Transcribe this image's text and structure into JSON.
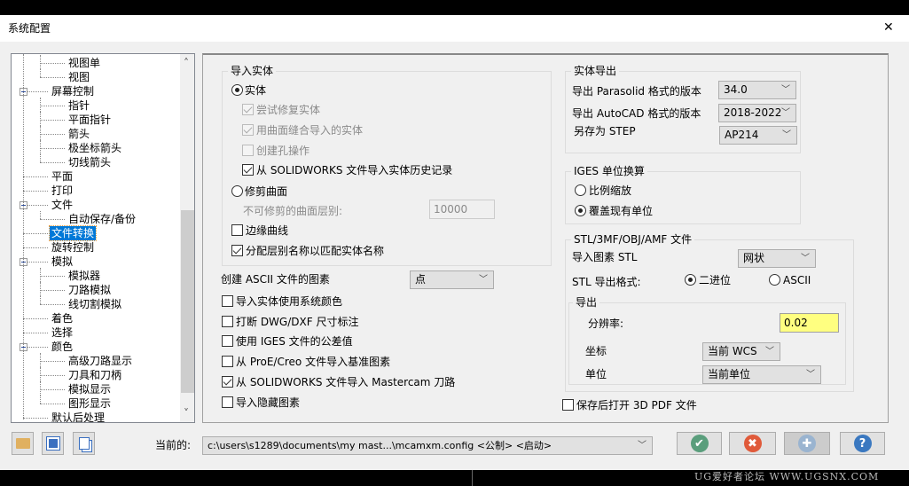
{
  "window": {
    "title": "系统配置",
    "close": "✕"
  },
  "tree": {
    "items": [
      {
        "label": "视图单",
        "level": 2
      },
      {
        "label": "视图",
        "level": 2,
        "last": true
      },
      {
        "label": "屏幕控制",
        "level": 1,
        "expander": true
      },
      {
        "label": "指针",
        "level": 2
      },
      {
        "label": "平面指针",
        "level": 2
      },
      {
        "label": "箭头",
        "level": 2
      },
      {
        "label": "极坐标箭头",
        "level": 2
      },
      {
        "label": "切线箭头",
        "level": 2,
        "last": true
      },
      {
        "label": "平面",
        "level": 1
      },
      {
        "label": "打印",
        "level": 1
      },
      {
        "label": "文件",
        "level": 1,
        "expander": true
      },
      {
        "label": "自动保存/备份",
        "level": 2,
        "last": true
      },
      {
        "label": "文件转换",
        "level": 1,
        "selected": true
      },
      {
        "label": "旋转控制",
        "level": 1
      },
      {
        "label": "模拟",
        "level": 1,
        "expander": true
      },
      {
        "label": "模拟器",
        "level": 2
      },
      {
        "label": "刀路模拟",
        "level": 2
      },
      {
        "label": "线切割模拟",
        "level": 2,
        "last": true
      },
      {
        "label": "着色",
        "level": 1
      },
      {
        "label": "选择",
        "level": 1
      },
      {
        "label": "颜色",
        "level": 1,
        "expander": true
      },
      {
        "label": "高级刀路显示",
        "level": 2
      },
      {
        "label": "刀具和刀柄",
        "level": 2
      },
      {
        "label": "模拟显示",
        "level": 2
      },
      {
        "label": "图形显示",
        "level": 2,
        "last": true
      },
      {
        "label": "默认后处理",
        "level": 1
      }
    ],
    "scroll_up": "˄",
    "scroll_down": "˅"
  },
  "import_solids": {
    "title": "导入实体",
    "solid_radio": "实体",
    "try_repair": "尝试修复实体",
    "stitch": "用曲面缝合导入的实体",
    "hole_ops": "创建孔操作",
    "sw_history": "从 SOLIDWORKS 文件导入实体历史记录",
    "trimmed_radio": "修剪曲面",
    "untrimmed_level_label": "不可修剪的曲面层别:",
    "untrimmed_level_value": "10000",
    "edge_curves": "边缘曲线",
    "assign_levels": "分配层别名称以匹配实体名称"
  },
  "ascii": {
    "label": "创建 ASCII 文件的图素",
    "value": "点"
  },
  "options": {
    "sys_colors": "导入实体使用系统颜色",
    "break_dims": "打断 DWG/DXF 尺寸标注",
    "iges_tol": "使用 IGES 文件的公差值",
    "proe_datum": "从 ProE/Creo 文件导入基准图素",
    "sw_mastercam": "从 SOLIDWORKS 文件导入 Mastercam 刀路",
    "hidden": "导入隐藏图素"
  },
  "solid_export": {
    "title": "实体导出",
    "parasolid_label": "导出 Parasolid 格式的版本",
    "parasolid_value": "34.0",
    "autocad_label": "导出 AutoCAD 格式的版本",
    "autocad_value": "2018-2022",
    "step_label": "另存为 STEP",
    "step_value": "AP214"
  },
  "iges_units": {
    "title": "IGES 单位换算",
    "scale": "比例缩放",
    "override": "覆盖现有单位"
  },
  "stl": {
    "title": "STL/3MF/OBJ/AMF 文件",
    "import_label": "导入图素 STL",
    "import_value": "网状",
    "format_label": "STL 导出格式:",
    "binary": "二进位",
    "ascii": "ASCII",
    "export": {
      "title": "导出",
      "resolution_label": "分辨率:",
      "resolution_value": "0.02",
      "coord_label": "坐标",
      "coord_value": "当前 WCS",
      "units_label": "单位",
      "units_value": "当前单位"
    }
  },
  "open_3dpdf": "保存后打开 3D PDF 文件",
  "footer": {
    "current_label": "当前的:",
    "current_value": "c:\\users\\s1289\\documents\\my mast...\\mcamxm.config <公制> <启动>",
    "ok": "✔",
    "cancel": "✖",
    "add": "✚",
    "help": "?"
  },
  "watermark": "UG爱好者论坛 WWW.UGSNX.COM",
  "colors": {
    "selected": "#0078d7",
    "ok": "#5a9e7c",
    "cancel": "#e05a3a",
    "add": "#9ab4d0",
    "help": "#3a78c0",
    "yellow": "#ffff80"
  }
}
